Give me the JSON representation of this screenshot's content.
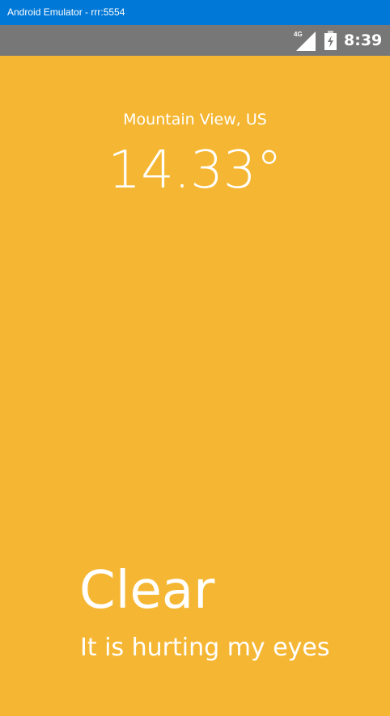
{
  "window": {
    "title": "Android Emulator - rrr:5554",
    "background": "#f5b733",
    "titlebar_color": "#0078d7"
  },
  "status_bar": {
    "background": "#777777",
    "network_label": "4G",
    "network_icon": "cell-signal-icon",
    "battery_icon": "battery-charging-icon",
    "time": "8:39"
  },
  "weather": {
    "city": "Mountain View, US",
    "temperature": "14.33°",
    "condition": "Clear",
    "description": "It is hurting my eyes"
  }
}
